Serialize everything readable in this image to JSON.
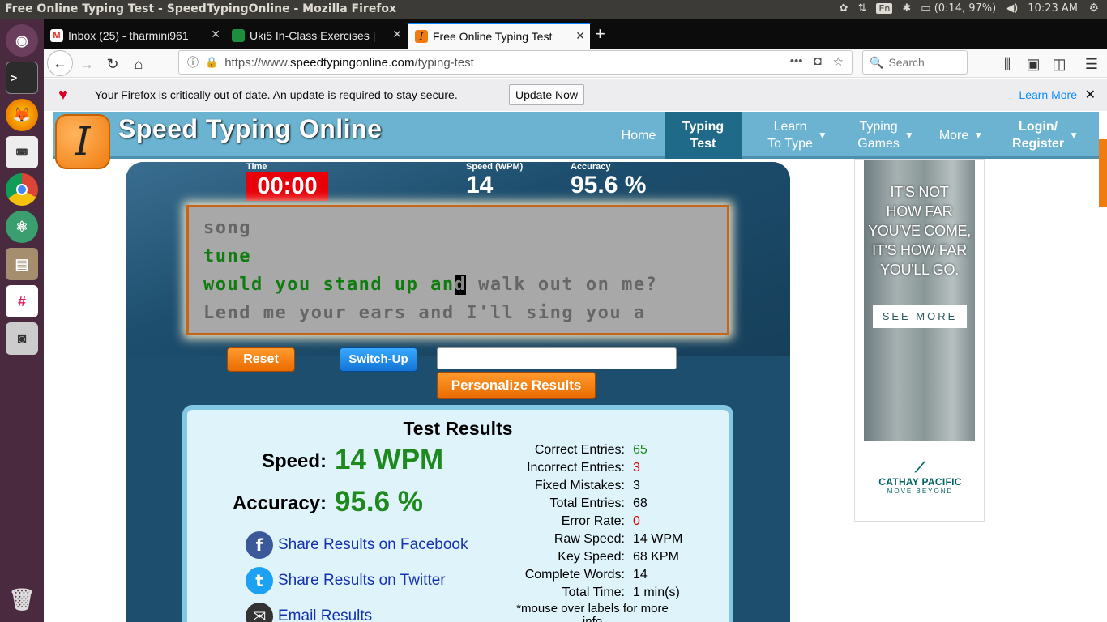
{
  "os": {
    "window_title": "Free Online Typing Test - SpeedTypingOnline - Mozilla Firefox",
    "lang": "En",
    "battery": "(0:14, 97%)",
    "clock": "10:23 AM"
  },
  "launcher": {
    "items": [
      "ubuntu-dash",
      "terminal",
      "firefox",
      "keyboard",
      "chrome",
      "atom",
      "files",
      "slack",
      "screenshot",
      "trash"
    ]
  },
  "browser": {
    "tabs": [
      {
        "label": "Inbox (25) - tharmini961",
        "icon": "gmail-icon",
        "color": "#d93025"
      },
      {
        "label": "Uki5 In-Class Exercises |",
        "icon": "classroom-icon",
        "color": "#1e8e3e"
      },
      {
        "label": "Free Online Typing Test",
        "icon": "speedtyping-icon",
        "color": "#f07c10"
      }
    ],
    "url_prefix": "https://www.",
    "url_domain": "speedtypingonline.com",
    "url_path": "/typing-test",
    "search_placeholder": "Search",
    "notification": {
      "message": "Your Firefox is critically out of date. An update is required to stay secure.",
      "button": "Update Now",
      "link": "Learn More"
    }
  },
  "site": {
    "logo_letter": "I",
    "name": "Speed Typing Online",
    "menu": [
      {
        "line1": "Home",
        "line2": ""
      },
      {
        "line1": "Typing",
        "line2": "Test"
      },
      {
        "line1": "Learn",
        "line2": "To Type"
      },
      {
        "line1": "Typing",
        "line2": "Games"
      },
      {
        "line1": "More",
        "line2": ""
      },
      {
        "line1": "Login/",
        "line2": "Register"
      }
    ]
  },
  "test": {
    "time_label": "Time",
    "time": "00:00",
    "speed_label": "Speed (WPM)",
    "speed": "14",
    "accuracy_label": "Accuracy",
    "accuracy": "95.6 %",
    "lines": {
      "l1": "song",
      "l2": "tune",
      "l3_typed": "would you stand up an",
      "l3_cursor": "d",
      "l3_rest": " walk out on me?",
      "l4": "Lend me your ears and I'll sing you a"
    },
    "reset": "Reset",
    "switch": "Switch-Up",
    "personalize": "Personalize Results"
  },
  "results": {
    "title": "Test Results",
    "speed_label": "Speed:",
    "speed_value": "14 WPM",
    "accuracy_label": "Accuracy:",
    "accuracy_value": "95.6 %",
    "share": [
      {
        "label": "Share Results on Facebook",
        "icon": "facebook-icon"
      },
      {
        "label": "Share Results on Twitter",
        "icon": "twitter-icon"
      },
      {
        "label": "Email Results",
        "icon": "email-icon"
      }
    ],
    "stats": [
      {
        "label": "Correct Entries:",
        "value": "65"
      },
      {
        "label": "Incorrect Entries:",
        "value": "3"
      },
      {
        "label": "Fixed Mistakes:",
        "value": "3"
      },
      {
        "label": "Total Entries:",
        "value": "68"
      },
      {
        "label": "Error Rate:",
        "value": "0"
      },
      {
        "label": "Raw Speed:",
        "value": "14 WPM"
      },
      {
        "label": "Key Speed:",
        "value": "68 KPM"
      },
      {
        "label": "Complete Words:",
        "value": "14"
      },
      {
        "label": "Total Time:",
        "value": "1 min(s)"
      }
    ],
    "note": "*mouse over labels for more info"
  },
  "ad": {
    "line1": "IT'S NOT",
    "line2": "HOW FAR",
    "line3": "YOU'VE COME,",
    "line4": "IT'S HOW FAR",
    "line5": "YOU'LL GO.",
    "cta": "SEE MORE",
    "brand": "CATHAY PACIFIC",
    "tagline": "MOVE BEYOND"
  }
}
